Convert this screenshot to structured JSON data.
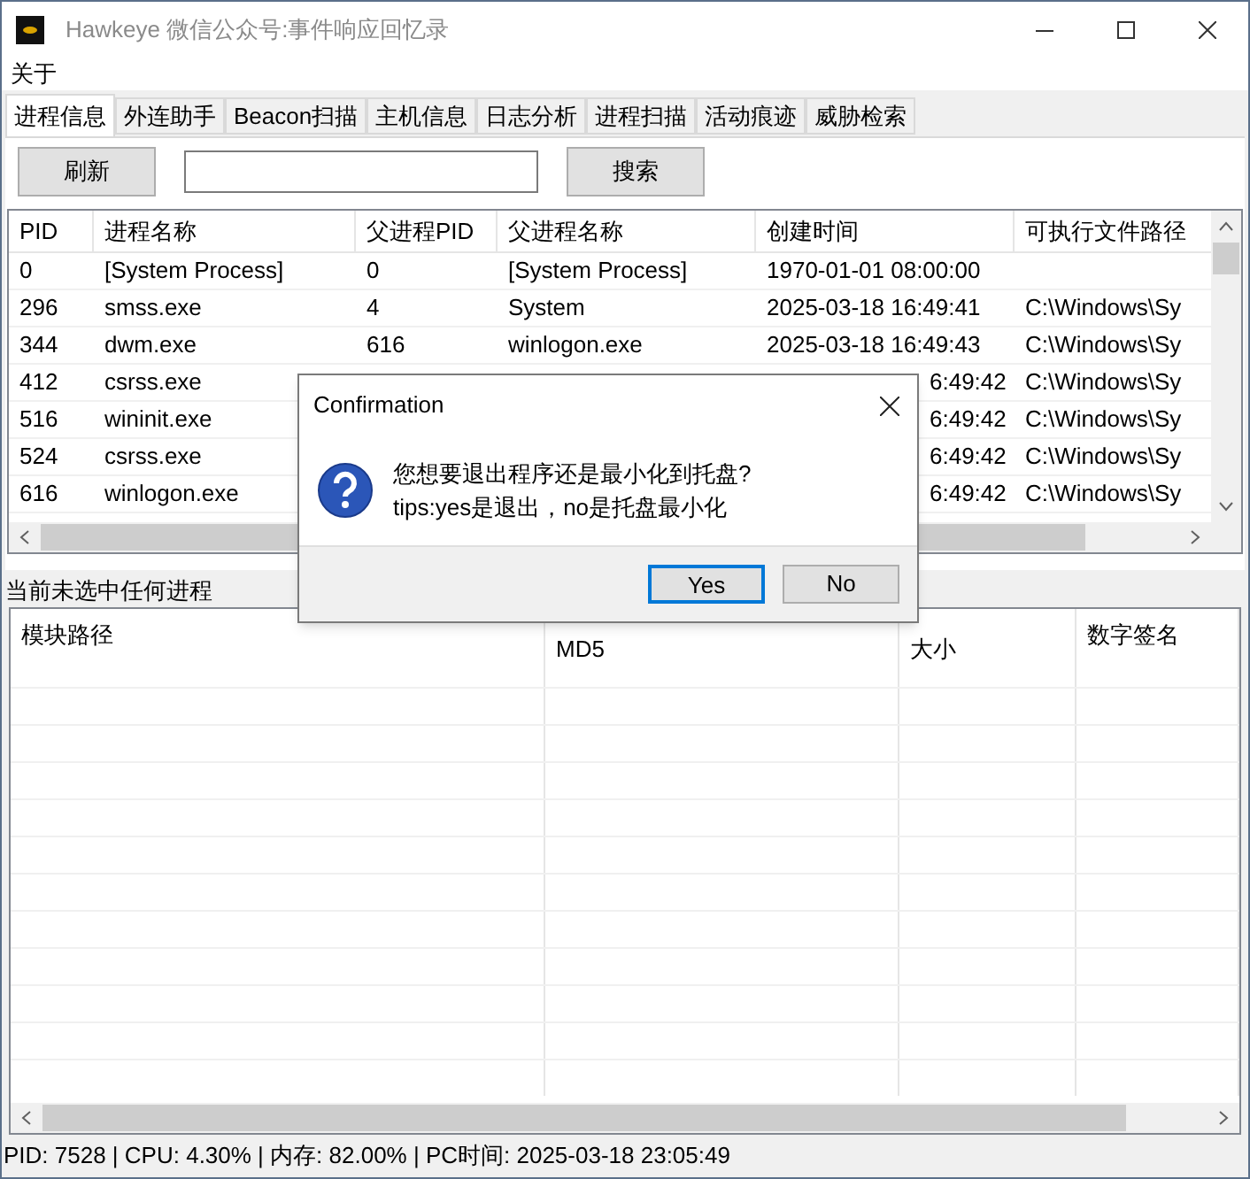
{
  "window": {
    "title": "Hawkeye 微信公众号:事件响应回忆录"
  },
  "menu": [
    "关于"
  ],
  "tabs": [
    {
      "label": "进程信息",
      "selected": true
    },
    {
      "label": "外连助手",
      "selected": false
    },
    {
      "label": "Beacon扫描",
      "selected": false
    },
    {
      "label": "主机信息",
      "selected": false
    },
    {
      "label": "日志分析",
      "selected": false
    },
    {
      "label": "进程扫描",
      "selected": false
    },
    {
      "label": "活动痕迹",
      "selected": false
    },
    {
      "label": "威胁检索",
      "selected": false
    }
  ],
  "toolbar": {
    "refresh_button": "刷新",
    "search_button": "搜索"
  },
  "process_table": {
    "columns": [
      "PID",
      "进程名称",
      "父进程PID",
      "父进程名称",
      "创建时间",
      "可执行文件路径"
    ],
    "rows": [
      {
        "kind": "full",
        "cells": [
          "0",
          "[System Process]",
          "0",
          "[System Process]",
          "1970-01-01 08:00:00",
          ""
        ]
      },
      {
        "kind": "full",
        "cells": [
          "296",
          "smss.exe",
          "4",
          "System",
          "2025-03-18 16:49:41",
          "C:\\Windows\\Sy"
        ]
      },
      {
        "kind": "full",
        "cells": [
          "344",
          "dwm.exe",
          "616",
          "winlogon.exe",
          "2025-03-18 16:49:43",
          "C:\\Windows\\Sy"
        ]
      },
      {
        "kind": "covered",
        "pid": "412",
        "name": "csrss.exe",
        "time": "6:49:42",
        "path": "C:\\Windows\\Sy"
      },
      {
        "kind": "covered",
        "pid": "516",
        "name": "wininit.exe",
        "time": "6:49:42",
        "path": "C:\\Windows\\Sy"
      },
      {
        "kind": "covered",
        "pid": "524",
        "name": "csrss.exe",
        "time": "6:49:42",
        "path": "C:\\Windows\\Sy"
      },
      {
        "kind": "covered",
        "pid": "616",
        "name": "winlogon.exe",
        "time": "6:49:42",
        "path": "C:\\Windows\\Sy"
      }
    ]
  },
  "selection_label": "当前未选中任何进程",
  "module_table": {
    "columns": [
      "模块路径",
      "MD5",
      "大小",
      "数字签名"
    ]
  },
  "status_bar": "PID: 7528 | CPU: 4.30% | 内存: 82.00% | PC时间: 2025-03-18 23:05:49",
  "dialog": {
    "title": "Confirmation",
    "message": [
      "您想要退出程序还是最小化到托盘?",
      "tips:yes是退出，no是托盘最小化"
    ],
    "buttons": [
      {
        "label": "Yes",
        "selected": true
      },
      {
        "label": "No",
        "selected": false
      }
    ]
  }
}
